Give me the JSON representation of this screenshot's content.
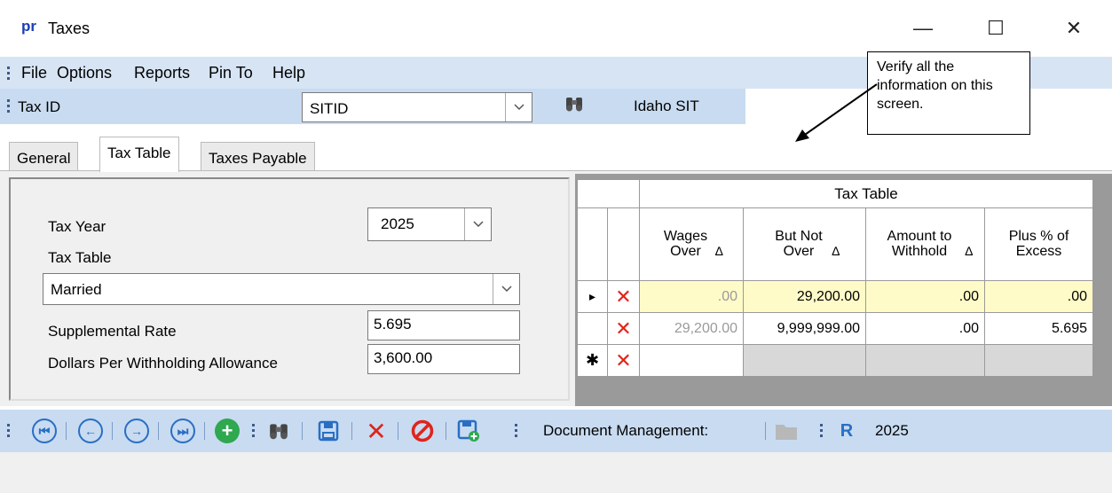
{
  "window": {
    "logo": "pr",
    "title": "Taxes",
    "minimize": "—",
    "maximize": "☐",
    "close": "✕"
  },
  "menu": [
    "File",
    "Options",
    "Reports",
    "Pin To",
    "Help"
  ],
  "taxid": {
    "label": "Tax ID",
    "value": "SITID",
    "description": "Idaho SIT"
  },
  "callout": "Verify all the information on this screen.",
  "tabs": [
    "General",
    "Tax Table",
    "Taxes Payable"
  ],
  "form": {
    "tax_year_label": "Tax Year",
    "tax_year": "2025",
    "tax_table_label": "Tax Table",
    "tax_table": "Married",
    "supplemental_label": "Supplemental Rate",
    "supplemental": "5.695",
    "dollars_label": "Dollars Per Withholding Allowance",
    "dollars": "3,600.00"
  },
  "grid": {
    "title": "Tax Table",
    "headers": [
      "Wages Over",
      "But Not Over",
      "Amount to Withhold",
      "Plus % of Excess"
    ],
    "sort_glyph": "∆",
    "current_marker": "▸",
    "new_marker": "✱",
    "delete_glyph": "✕",
    "rows": [
      {
        "wages_over": ".00",
        "but_not_over": "29,200.00",
        "amount": ".00",
        "plus": ".00"
      },
      {
        "wages_over": "29,200.00",
        "but_not_over": "9,999,999.00",
        "amount": ".00",
        "plus": "5.695"
      }
    ]
  },
  "toolbar": {
    "doc_mgmt": "Document Management:",
    "year": "2025"
  },
  "icons": [
    "first-icon",
    "previous-icon",
    "next-icon",
    "last-icon",
    "add-icon",
    "find-icon",
    "save-icon",
    "delete-icon",
    "cancel-icon",
    "save-new-icon",
    "folder-icon",
    "report-icon",
    "binoculars-icon"
  ],
  "colors": {
    "menubar": "#d7e4f4",
    "toolbar": "#c8dbf1",
    "delete_red": "#e0241b",
    "nav_blue": "#2a6ec4",
    "highlight_row": "#fffbc8"
  }
}
